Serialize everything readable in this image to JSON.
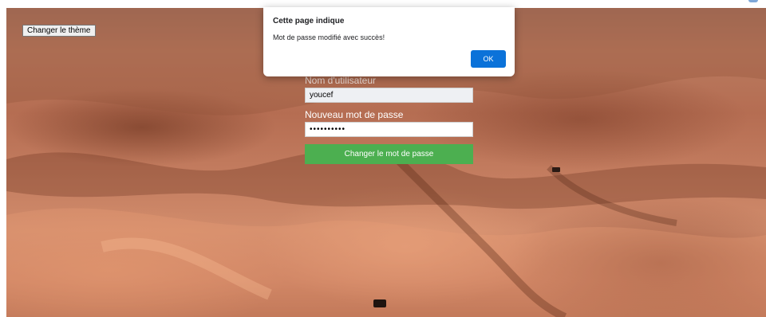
{
  "page": {
    "theme_button_label": "Changer le thème"
  },
  "form": {
    "username_label": "Nom d'utilisateur",
    "username_value": "youcef",
    "password_label": "Nouveau mot de passe",
    "password_value": "secret1234",
    "submit_label": "Changer le mot de passe"
  },
  "alert": {
    "title": "Cette page indique",
    "message": "Mot de passe modifié avec succès!",
    "ok_label": "OK"
  },
  "colors": {
    "submit_green": "#4caf50",
    "ok_blue": "#0b72d9",
    "label_white": "#ffffff"
  },
  "background": {
    "scene": "desert-dunes-background"
  }
}
